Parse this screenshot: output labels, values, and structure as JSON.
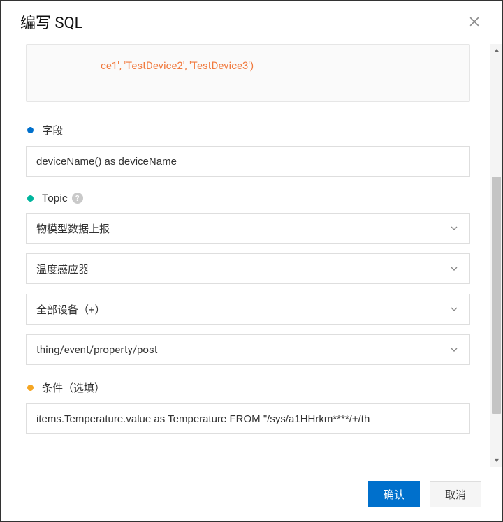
{
  "header": {
    "title": "编写 SQL"
  },
  "code": {
    "line": "ce1', 'TestDevice2', 'TestDevice3')"
  },
  "fields": {
    "section_label": "字段",
    "value": "deviceName() as deviceName"
  },
  "topic": {
    "section_label": "Topic",
    "select1": "物模型数据上报",
    "select2": "温度感应器",
    "select3": "全部设备（+）",
    "select4": "thing/event/property/post"
  },
  "condition": {
    "section_label": "条件（选填）",
    "value": "items.Temperature.value as Temperature FROM \"/sys/a1HHrkm****/+/th"
  },
  "footer": {
    "confirm": "确认",
    "cancel": "取消"
  }
}
